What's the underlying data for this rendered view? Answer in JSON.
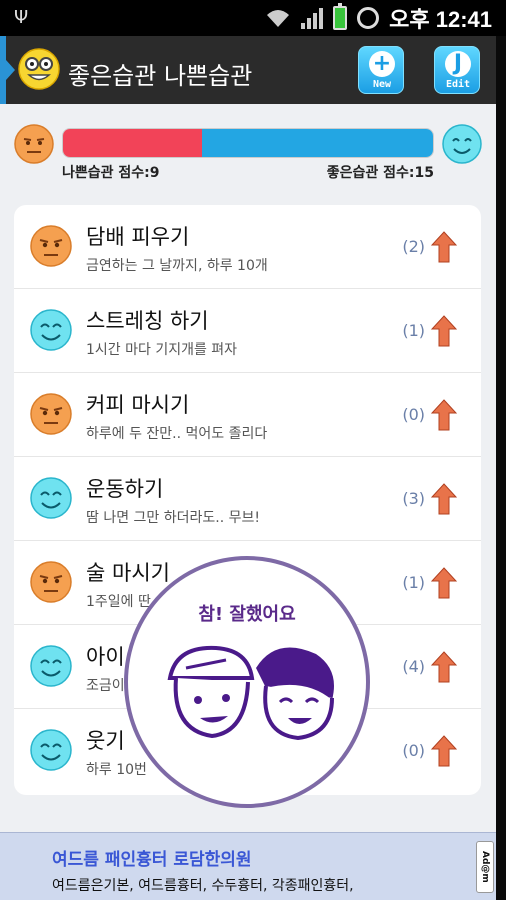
{
  "status_bar": {
    "time": "오후 12:41",
    "icons": [
      "usb-icon",
      "wifi-icon",
      "signal-icon",
      "battery-icon",
      "alarm-icon"
    ]
  },
  "header": {
    "title": "좋은습관 나쁜습관",
    "new_label": "New",
    "edit_label": "Edit",
    "accent_color": "#2a93d5"
  },
  "score": {
    "bad_label": "나쁜습관 점수:9",
    "good_label": "좋은습관 점수:15",
    "bad_value": 9,
    "good_value": 15,
    "bad_color": "#f24358",
    "good_color": "#23a6e3"
  },
  "habits": [
    {
      "name": "담배 피우기",
      "desc": "금연하는 그 날까지, 하루 10개",
      "count": "(2)",
      "type": "bad"
    },
    {
      "name": "스트레칭 하기",
      "desc": "1시간 마다 기지개를 펴자",
      "count": "(1)",
      "type": "good"
    },
    {
      "name": "커피 마시기",
      "desc": "하루에 두 잔만.. 먹어도 졸리다",
      "count": "(0)",
      "type": "bad"
    },
    {
      "name": "운동하기",
      "desc": "땀 나면 그만 하더라도.. 무브!",
      "count": "(3)",
      "type": "good"
    },
    {
      "name": "술 마시기",
      "desc": "1주일에 딴",
      "count": "(1)",
      "type": "bad"
    },
    {
      "name": "아이",
      "desc": "조금이",
      "count": "(4)",
      "type": "good"
    },
    {
      "name": "웃기",
      "desc": "하루  10번",
      "count": "(0)",
      "type": "good"
    }
  ],
  "stamp": {
    "text": "참! 잘했어요"
  },
  "ad": {
    "title": "여드름 패인흉터 로담한의원",
    "desc": "여드름은기본, 여드름흉터, 수두흉터, 각종패인흉터,",
    "badge": "Ad@m"
  }
}
